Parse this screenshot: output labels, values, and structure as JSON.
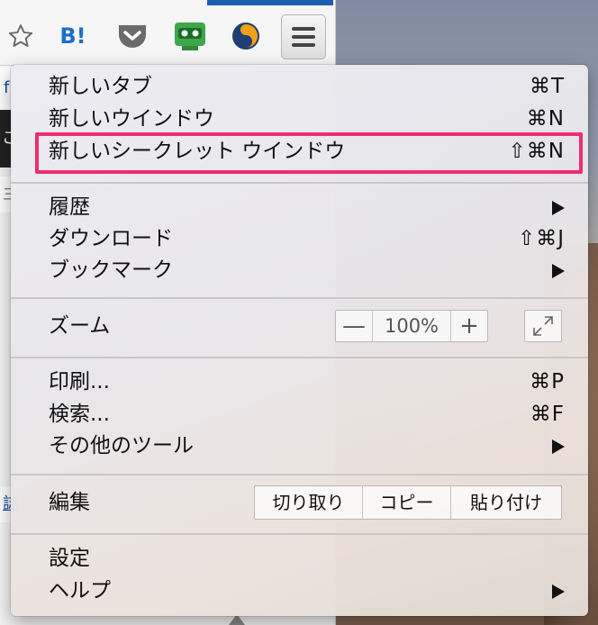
{
  "toolbar": {
    "icons": [
      "star-icon",
      "hatena-bookmark-icon",
      "pocket-icon",
      "roboform-icon",
      "sumo-icon",
      "hamburger-menu-icon"
    ],
    "hatena_label": "B!"
  },
  "page_fragments": {
    "f1": "f",
    "f2": "こ",
    "f3": "三",
    "f4": "誌"
  },
  "menu": {
    "new_tab": {
      "label": "新しいタブ",
      "shortcut": "⌘T"
    },
    "new_window": {
      "label": "新しいウインドウ",
      "shortcut": "⌘N"
    },
    "new_incognito": {
      "label": "新しいシークレット ウインドウ",
      "shortcut": "⇧⌘N",
      "highlighted": true
    },
    "history": {
      "label": "履歴"
    },
    "downloads": {
      "label": "ダウンロード",
      "shortcut": "⇧⌘J"
    },
    "bookmarks": {
      "label": "ブックマーク"
    },
    "zoom": {
      "label": "ズーム",
      "minus": "—",
      "value": "100%",
      "plus": "+"
    },
    "print": {
      "label": "印刷...",
      "shortcut": "⌘P"
    },
    "find": {
      "label": "検索...",
      "shortcut": "⌘F"
    },
    "more_tools": {
      "label": "その他のツール"
    },
    "edit": {
      "label": "編集",
      "cut": "切り取り",
      "copy": "コピー",
      "paste": "貼り付け"
    },
    "settings": {
      "label": "設定"
    },
    "help": {
      "label": "ヘルプ"
    }
  },
  "colors": {
    "highlight": "#ef2d6d",
    "hatena": "#1e6ec8"
  }
}
